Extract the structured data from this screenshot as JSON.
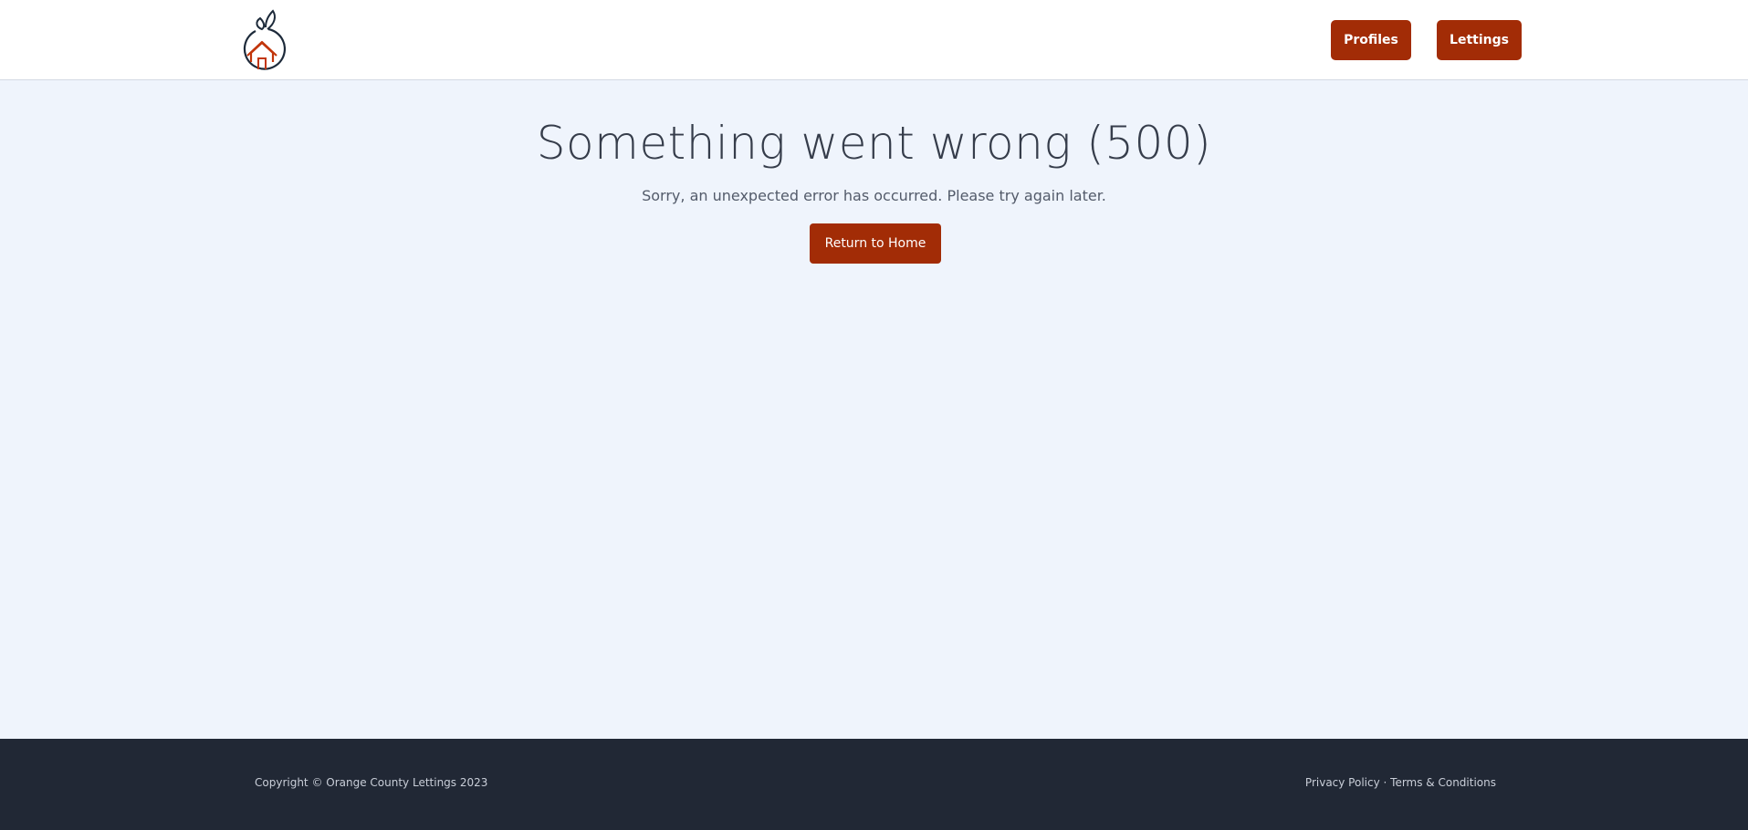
{
  "header": {
    "logo_icon": "orange-house-logo-icon",
    "nav": {
      "profiles_label": "Profiles",
      "lettings_label": "Lettings"
    }
  },
  "main": {
    "title": "Something went wrong (500)",
    "message": "Sorry, an unexpected error has occurred. Please try again later.",
    "home_button_label": "Return to Home"
  },
  "footer": {
    "copyright": "Copyright © Orange County Lettings 2023",
    "privacy_label": "Privacy Policy",
    "separator": " · ",
    "terms_label": "Terms & Conditions"
  },
  "colors": {
    "accent": "#a22c06",
    "page_background": "#eff4fc",
    "footer_background": "#212835",
    "heading_text": "#363d4b"
  }
}
